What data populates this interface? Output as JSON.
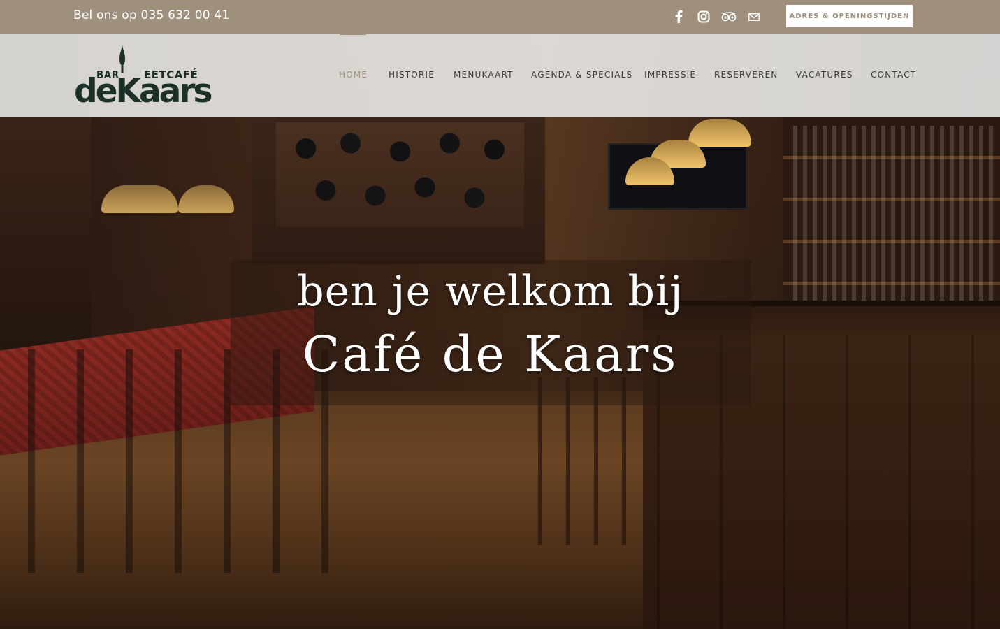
{
  "topbar": {
    "phone_text": "Bel ons op 035 632 00 41",
    "socials": [
      "facebook-icon",
      "instagram-icon",
      "tripadvisor-icon",
      "mail-icon"
    ],
    "adres_button": "ADRES & OPENINGSTIJDEN",
    "background_color": "#9e907d"
  },
  "logo": {
    "bar": "BAR",
    "eetcafe": "EETCAFÉ",
    "name": "deKaars",
    "color": "#1c3028"
  },
  "nav": {
    "items": [
      {
        "label": "HOME",
        "active": true
      },
      {
        "label": "HISTORIE",
        "active": false
      },
      {
        "label": "MENUKAART",
        "active": false
      },
      {
        "label": "AGENDA & SPECIALS",
        "active": false
      },
      {
        "label": "IMPRESSIE",
        "active": false
      },
      {
        "label": "RESERVEREN",
        "active": false
      },
      {
        "label": "VACATURES",
        "active": false
      },
      {
        "label": "CONTACT",
        "active": false
      }
    ],
    "active_color": "#9e907d"
  },
  "hero": {
    "line1": "ben je welkom bij",
    "line2": "Café de Kaars"
  }
}
